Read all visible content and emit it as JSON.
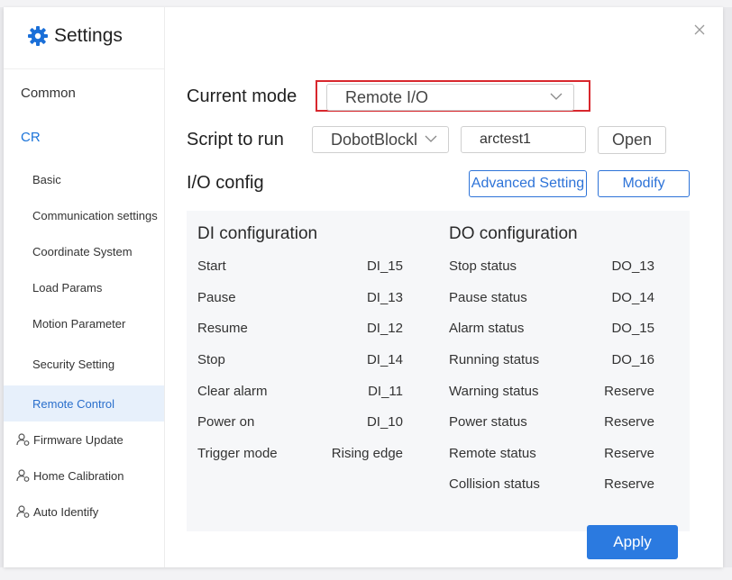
{
  "window": {
    "title": "Settings"
  },
  "sidebar": {
    "common": "Common",
    "cr": "CR",
    "items": [
      "Basic",
      "Communication settings",
      "Coordinate System",
      "Load Params",
      "Motion Parameter",
      "Security Setting",
      "Remote Control"
    ],
    "extras": [
      "Firmware Update",
      "Home Calibration",
      "Auto Identify"
    ],
    "active": "Remote Control"
  },
  "form": {
    "current_mode_label": "Current mode",
    "current_mode_value": "Remote I/O",
    "script_label": "Script to run",
    "script_select_value": "DobotBlockly",
    "script_name": "arctest1",
    "open_button": "Open",
    "io_config_label": "I/O config",
    "advanced_button": "Advanced Setting",
    "modify_button": "Modify",
    "apply_button": "Apply"
  },
  "di_config": {
    "title": "DI configuration",
    "rows": [
      {
        "name": "Start",
        "value": "DI_15"
      },
      {
        "name": "Pause",
        "value": "DI_13"
      },
      {
        "name": "Resume",
        "value": "DI_12"
      },
      {
        "name": "Stop",
        "value": "DI_14"
      },
      {
        "name": "Clear alarm",
        "value": "DI_11"
      },
      {
        "name": "Power on",
        "value": "DI_10"
      },
      {
        "name": "Trigger mode",
        "value": "Rising edge"
      }
    ]
  },
  "do_config": {
    "title": "DO configuration",
    "rows": [
      {
        "name": "Stop status",
        "value": "DO_13"
      },
      {
        "name": "Pause status",
        "value": "DO_14"
      },
      {
        "name": "Alarm status",
        "value": "DO_15"
      },
      {
        "name": "Running status",
        "value": "DO_16"
      },
      {
        "name": "Warning status",
        "value": "Reserve"
      },
      {
        "name": "Power status",
        "value": "Reserve"
      },
      {
        "name": "Remote status",
        "value": "Reserve"
      },
      {
        "name": "Collision status",
        "value": "Reserve"
      }
    ]
  },
  "colors": {
    "accent": "#2b7ae0",
    "highlight": "#d8272d",
    "active_nav_bg": "#e7f0fb",
    "panel_bg": "#f6f7f9"
  },
  "icons": {
    "brand": "gear-icon",
    "close": "close-icon",
    "dropdown": "chevron-down-icon",
    "extras": "user-gear-icon"
  }
}
